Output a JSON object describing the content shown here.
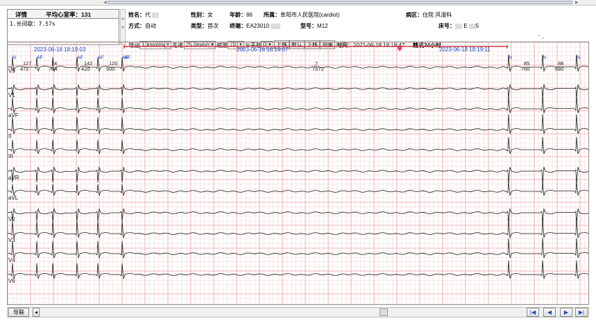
{
  "panel": {
    "tab_detail": "详情",
    "avg_rate_label": "平均心室率：131",
    "note": "1.长间歇：7.57s"
  },
  "patient": {
    "name_label": "姓名：",
    "name_value": "代",
    "sex_label": "性别：",
    "sex_value": "女",
    "age_label": "年龄：",
    "age_value": "86",
    "hospital_label": "所属：",
    "hospital_value": "阜阳市人民医院(cardiot)",
    "ward_label": "病区：",
    "ward_value": "住院 风湿科",
    "mode_label": "方式：",
    "mode_value": "自动",
    "type_label": "类型：",
    "type_value": "首次",
    "terminal_label": "终端：",
    "terminal_value": "EA23010",
    "model_label": "型号：",
    "model_value": "M12",
    "bed_label": "床号：",
    "bed_value": "5",
    "time_label": "时间：",
    "time_value": "2023-06-18 18:18:47",
    "wear_label": "戴机24小时"
  },
  "controls": {
    "gain_label": "增益",
    "gain_value": "10mm/mv",
    "speed_label": "走速",
    "speed_value": "25.0mm/s",
    "zoom_label": "缩放",
    "zoom_value": "70",
    "pct_label": "%",
    "shift_label": "平移",
    "shift_value": "0",
    "up_button": "上移",
    "default_button": "默认",
    "down_button": "下移",
    "measure_button": "测量"
  },
  "strip": {
    "timestamps": [
      "2023-06-18 18:19:03",
      "2023-06-18 18:19:07",
      "2023-06-18 18:19:11"
    ],
    "beat_marks": [
      "N",
      "AF",
      "AF",
      "AF",
      "AF",
      "AF",
      "N",
      "N",
      "N"
    ],
    "rr_top": [
      "127",
      "74",
      "142",
      "120",
      "7",
      "85",
      "88"
    ],
    "rr_bottom": [
      "472",
      "784",
      "420",
      "500",
      "7572",
      "700",
      "680"
    ],
    "leads": [
      "V5",
      "V1",
      "aVF",
      "II",
      "III",
      "aVR",
      "aVL",
      "V2",
      "V3",
      "V4",
      "V6"
    ]
  },
  "footer": {
    "nav_button": "导联",
    "left_arrow": "◂",
    "first_button": "|◀",
    "prev_button": "◀",
    "next_button": "▶",
    "last_button": "▶|"
  },
  "colors": {
    "grid_minor": "#f6d3d3",
    "grid_major": "#ec9f9f",
    "trace": "#1a1a1a",
    "annot": "#1c44c8",
    "marker": "#c81e1e"
  }
}
